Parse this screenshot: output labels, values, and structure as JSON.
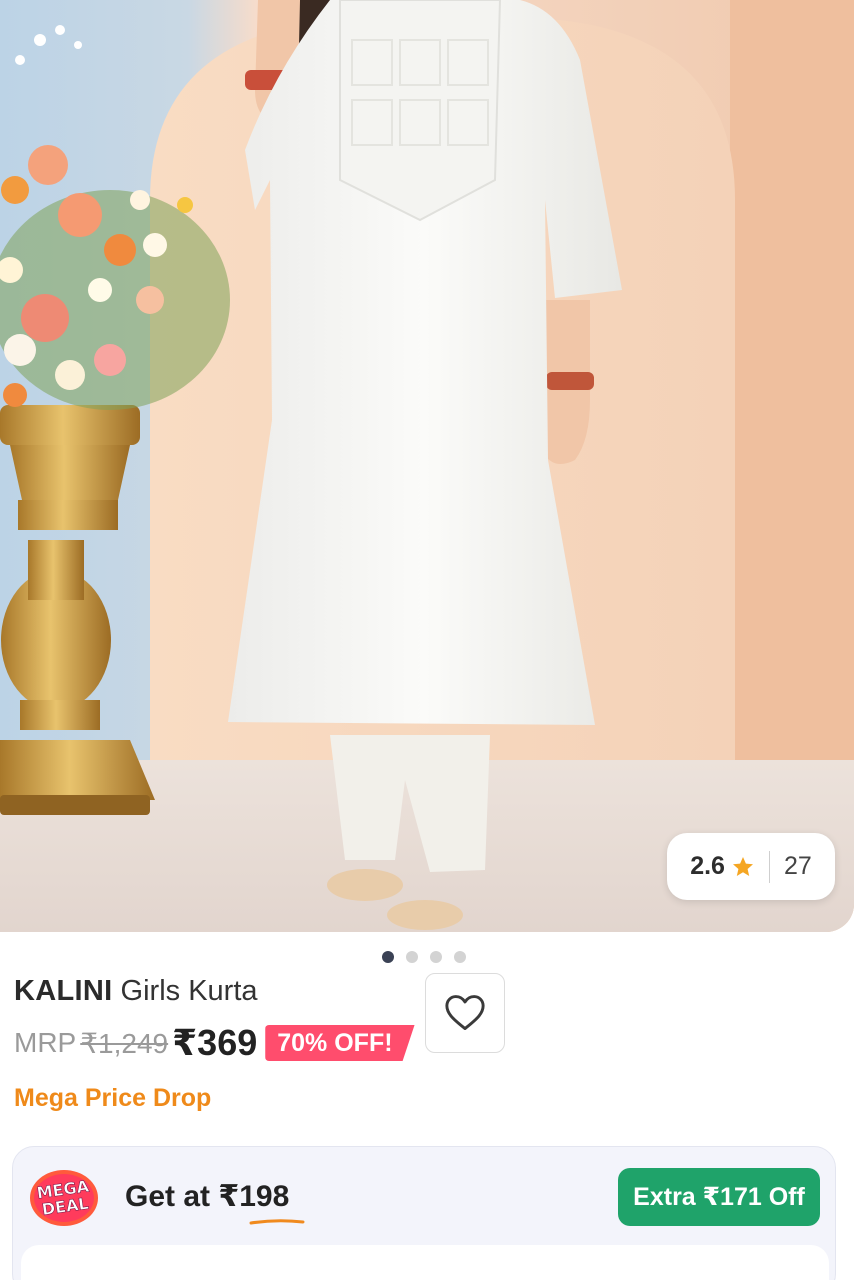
{
  "product_image": {
    "alt_icon": "product-photo",
    "rating": {
      "value": "2.6",
      "count": "27",
      "star_color": "#f5a623"
    },
    "pager": {
      "total": 4,
      "active": 0
    }
  },
  "product": {
    "brand": "KALINI",
    "name": "Girls Kurta",
    "mrp_label": "MRP",
    "mrp_value": "₹1,249",
    "price": "₹369",
    "discount_badge": "70% OFF!",
    "badge_color": "#ff4d6d",
    "promo_tag": "Mega Price Drop",
    "promo_color": "#ef8a1a"
  },
  "wishlist": {
    "icon": "heart-outline-icon"
  },
  "deal": {
    "logo_line1": "MEGA",
    "logo_line2": "DEAL",
    "text": "Get at ₹198",
    "button_label": "Extra ₹171 Off",
    "button_color": "#1fa36a"
  }
}
